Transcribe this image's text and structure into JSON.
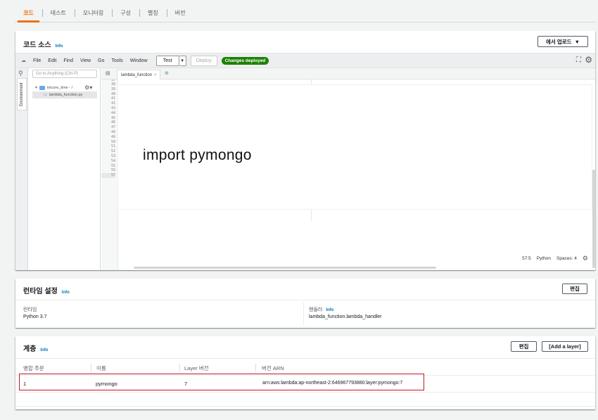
{
  "tabs": [
    {
      "label": "코드",
      "active": true
    },
    {
      "label": "테스트",
      "active": false
    },
    {
      "label": "모니터링",
      "active": false
    },
    {
      "label": "구성",
      "active": false
    },
    {
      "label": "별칭",
      "active": false
    },
    {
      "label": "버전",
      "active": false
    }
  ],
  "code_source": {
    "title": "코드 소스",
    "info": "Info",
    "upload_button": "에서 업로드",
    "menu": [
      "File",
      "Edit",
      "Find",
      "View",
      "Go",
      "Tools",
      "Window"
    ],
    "test_button": "Test",
    "deploy_button": "Deploy",
    "status_badge": "Changes deployed",
    "goto_placeholder": "Go to Anything (Ctrl-P)",
    "environment_tab": "Environment",
    "folder_name": "iotcore_time - /",
    "file_name": "lambda_function.py",
    "editor_tab": "lambda_function",
    "line_numbers": [
      "37",
      "38",
      "39",
      "40",
      "41",
      "42",
      "43",
      "44",
      "45",
      "46",
      "47",
      "48",
      "49",
      "50",
      "51",
      "52",
      "53",
      "54",
      "55",
      "56",
      "57"
    ],
    "code_overlay": "import pymongo",
    "status": {
      "position": "57:5",
      "language": "Python",
      "spaces": "Spaces: 4"
    }
  },
  "runtime": {
    "title": "런타임 설정",
    "info": "Info",
    "edit_button": "편집",
    "runtime_label": "런타임",
    "runtime_value": "Python 3.7",
    "handler_label": "핸들러",
    "handler_info": "Info",
    "handler_value": "lambda_function.lambda_handler"
  },
  "layers": {
    "title": "계층",
    "info": "Info",
    "edit_button": "편집",
    "add_button": "[Add a layer]",
    "columns": [
      "병합 주문",
      "이름",
      "Layer 버전",
      "버전 ARN"
    ],
    "rows": [
      {
        "order": "1",
        "name": "pymongo",
        "version": "7",
        "arn": "arn:aws:lambda:ap-northeast-2:646967793880:layer:pymongo:7"
      }
    ]
  },
  "colors": {
    "accent": "#ec7211",
    "success": "#1d8102",
    "highlight": "#c7162b",
    "link": "#0073bb"
  }
}
